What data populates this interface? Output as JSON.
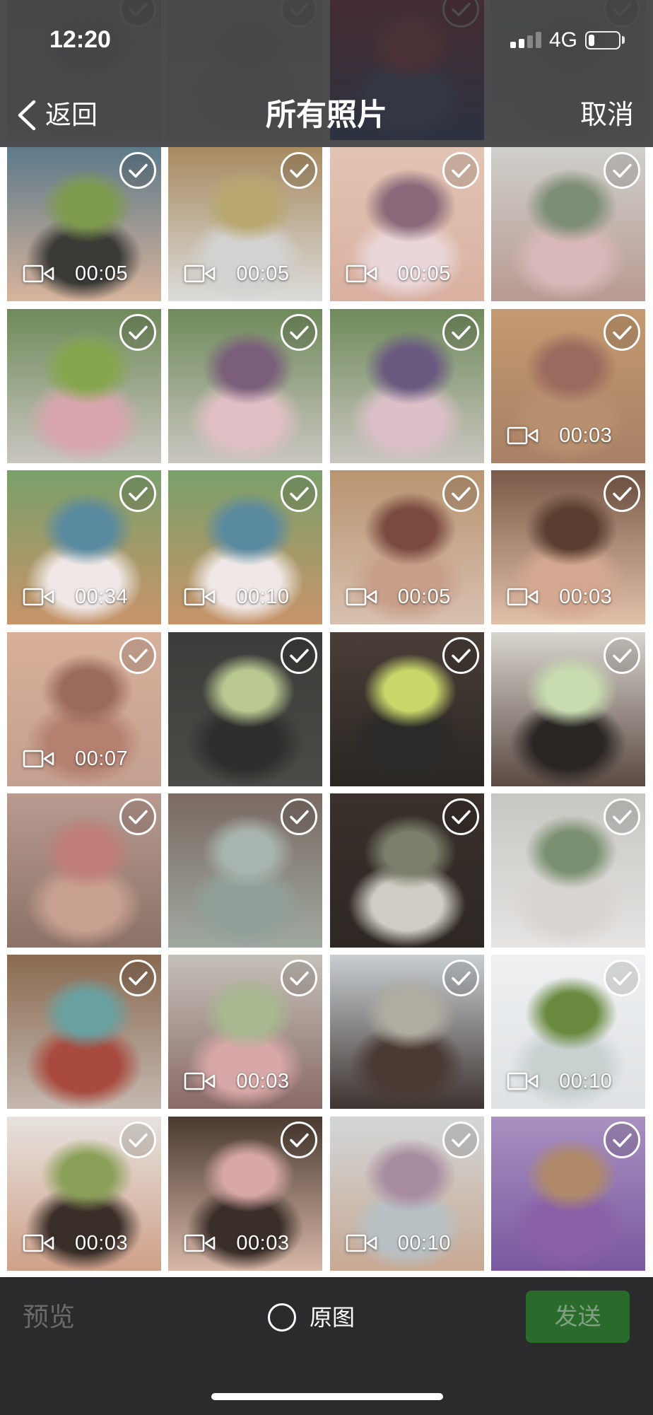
{
  "status_bar": {
    "time": "12:20",
    "network": "4G",
    "signal_level": 2,
    "signal_max": 4,
    "battery_level": 0.2
  },
  "nav": {
    "back_label": "返回",
    "title": "所有照片",
    "cancel_label": "取消"
  },
  "icons": {
    "back": "chevron-left-icon",
    "select": "check-circle-icon",
    "video": "video-camera-icon",
    "original": "radio-circle-icon"
  },
  "photos": [
    {
      "palette": [
        "#dcdcdc",
        "#efefef",
        "#d0d0d0",
        "#e6e6e6"
      ]
    },
    {
      "palette": [
        "#e9e9e9",
        "#f2f2f2",
        "#dedede",
        "#eaeaea"
      ]
    },
    {
      "palette": [
        "#d9324a",
        "#3d5fa8",
        "#e85a6a",
        "#6a7fb8"
      ]
    },
    {
      "palette": [
        "#e4e6ea",
        "#f0f0f2",
        "#d8dade",
        "#e8e8ea"
      ]
    },
    {
      "video_duration": "00:05",
      "palette": [
        "#5d7a8a",
        "#d8b49c",
        "#7e9a4e",
        "#3a3a36"
      ]
    },
    {
      "video_duration": "00:05",
      "palette": [
        "#a88a60",
        "#dcdcda",
        "#b8a870",
        "#d2d2d0"
      ]
    },
    {
      "video_duration": "00:05",
      "palette": [
        "#e2c4b4",
        "#d9b0a0",
        "#8a6a7a",
        "#ead6d8"
      ]
    },
    {
      "palette": [
        "#cfcfcb",
        "#b89a92",
        "#7e8e76",
        "#d8b8b8"
      ]
    },
    {
      "palette": [
        "#6f8a5a",
        "#c9c6c0",
        "#86a64e",
        "#d8a6ae"
      ]
    },
    {
      "palette": [
        "#6f8a5a",
        "#c9c6c0",
        "#7a5e7a",
        "#e0c0c4"
      ]
    },
    {
      "palette": [
        "#6f8a5a",
        "#c9c6c0",
        "#6a5a80",
        "#dcc0c8"
      ]
    },
    {
      "video_duration": "00:03",
      "palette": [
        "#c49a70",
        "#a88066",
        "#9a6a5e",
        "#b89070"
      ]
    },
    {
      "video_duration": "00:34",
      "palette": [
        "#7aa06a",
        "#c8946a",
        "#5a8aa0",
        "#f0e8e6"
      ]
    },
    {
      "video_duration": "00:10",
      "palette": [
        "#7aa06a",
        "#c8946a",
        "#5a8aa0",
        "#f0e8e6"
      ]
    },
    {
      "video_duration": "00:05",
      "palette": [
        "#b89470",
        "#d8c0b0",
        "#7a4a40",
        "#c8a08a"
      ]
    },
    {
      "video_duration": "00:03",
      "palette": [
        "#7a5a48",
        "#e2c0aa",
        "#5a3e30",
        "#d4a890"
      ]
    },
    {
      "video_duration": "00:07",
      "palette": [
        "#d8b09a",
        "#c4a090",
        "#9a6a5c",
        "#b48070"
      ]
    },
    {
      "palette": [
        "#3c3c3a",
        "#4a4a46",
        "#b8c890",
        "#2e2e2c"
      ]
    },
    {
      "palette": [
        "#4a3e38",
        "#2a2622",
        "#c8d66a",
        "#2a2a28"
      ]
    },
    {
      "palette": [
        "#d8d4ce",
        "#5a4a42",
        "#c8dcb0",
        "#2a2624"
      ]
    },
    {
      "palette": [
        "#b89a90",
        "#8a7266",
        "#c07e78",
        "#c8a090"
      ]
    },
    {
      "palette": [
        "#7a6a62",
        "#a0a8a0",
        "#a8b4ae",
        "#90a098"
      ]
    },
    {
      "palette": [
        "#3a302c",
        "#2e2824",
        "#7a7e6a",
        "#d0ccc4"
      ]
    },
    {
      "palette": [
        "#c8c6c2",
        "#e6e4e2",
        "#7a9070",
        "#d8d4d0"
      ]
    },
    {
      "palette": [
        "#8a6a50",
        "#c4b8b0",
        "#6aa0a0",
        "#a84a3e"
      ]
    },
    {
      "video_duration": "00:03",
      "palette": [
        "#c4c0b8",
        "#8a6a66",
        "#a8b890",
        "#d8a8a8"
      ]
    },
    {
      "palette": [
        "#c8ced2",
        "#3e3430",
        "#b0aca0",
        "#4a3a34"
      ]
    },
    {
      "video_duration": "00:10",
      "palette": [
        "#eef0f2",
        "#dfe2e4",
        "#6a8a40",
        "#c8d0d0"
      ]
    },
    {
      "video_duration": "00:03",
      "palette": [
        "#e6e2de",
        "#cfa088",
        "#8aa058",
        "#3a2e28"
      ]
    },
    {
      "video_duration": "00:03",
      "palette": [
        "#4a3a30",
        "#d8b8a8",
        "#d8a8a8",
        "#3a2e28"
      ]
    },
    {
      "video_duration": "00:10",
      "palette": [
        "#d2d6d8",
        "#c8a892",
        "#a88ca0",
        "#b8c0c4"
      ]
    },
    {
      "palette": [
        "#a890c0",
        "#7a58a0",
        "#b08a6a",
        "#8a60a8"
      ]
    }
  ],
  "toolbar": {
    "preview_label": "预览",
    "original_label": "原图",
    "send_label": "发送"
  },
  "colors": {
    "top_bar_bg": "#2a2a2c",
    "bottom_bar_bg": "#2b2b2d",
    "send_bg": "#2a6b2c",
    "send_text": "#80a282",
    "preview_text": "#6a6a6c",
    "text_primary": "#ffffff"
  }
}
